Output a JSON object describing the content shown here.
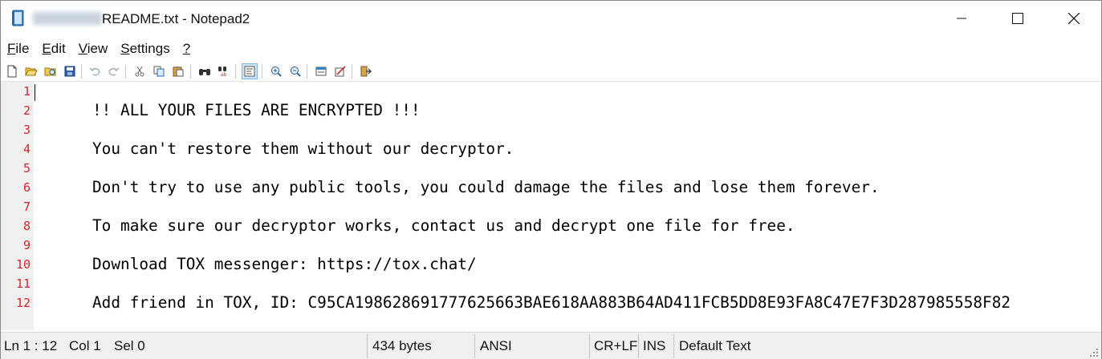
{
  "window": {
    "title_suffix": "README.txt - Notepad2",
    "app_icon": "notepad-icon",
    "controls": {
      "minimize": "minimize-icon",
      "maximize": "maximize-icon",
      "close": "close-icon"
    }
  },
  "menu": [
    {
      "underline": "F",
      "rest": "ile"
    },
    {
      "underline": "E",
      "rest": "dit"
    },
    {
      "underline": "V",
      "rest": "iew"
    },
    {
      "underline": "S",
      "rest": "ettings"
    },
    {
      "underline": "?",
      "rest": ""
    }
  ],
  "toolbar_icons": [
    "new-file-icon",
    "open-file-icon",
    "browse-icon",
    "save-icon",
    "undo-icon",
    "redo-icon",
    "cut-icon",
    "copy-icon",
    "paste-icon",
    "find-icon",
    "replace-icon",
    "word-wrap-icon",
    "zoom-in-icon",
    "zoom-out-icon",
    "scheme-icon",
    "customize-icon",
    "exit-icon"
  ],
  "editor": {
    "line_numbers": [
      "1",
      "2",
      "3",
      "4",
      "5",
      "6",
      "7",
      "8",
      "9",
      "10",
      "11",
      "12"
    ],
    "lines": [
      "",
      "!! ALL YOUR FILES ARE ENCRYPTED !!!",
      "",
      "You can't restore them without our decryptor.",
      "",
      "Don't try to use any public tools, you could damage the files and lose them forever.",
      "",
      "To make sure our decryptor works, contact us and decrypt one file for free.",
      "",
      "Download TOX messenger: https://tox.chat/",
      "",
      "Add friend in TOX, ID: C95CA198628691777625663BAE618AA883B64AD411FCB5DD8E93FA8C47E7F3D287985558F82"
    ],
    "line_number_color": "#d9232a"
  },
  "status": {
    "position": "Ln 1 : 12",
    "column": "Col 1",
    "selection": "Sel 0",
    "size": "434 bytes",
    "encoding": "ANSI",
    "line_ending": "CR+LF",
    "mode": "INS",
    "scheme": "Default Text"
  }
}
